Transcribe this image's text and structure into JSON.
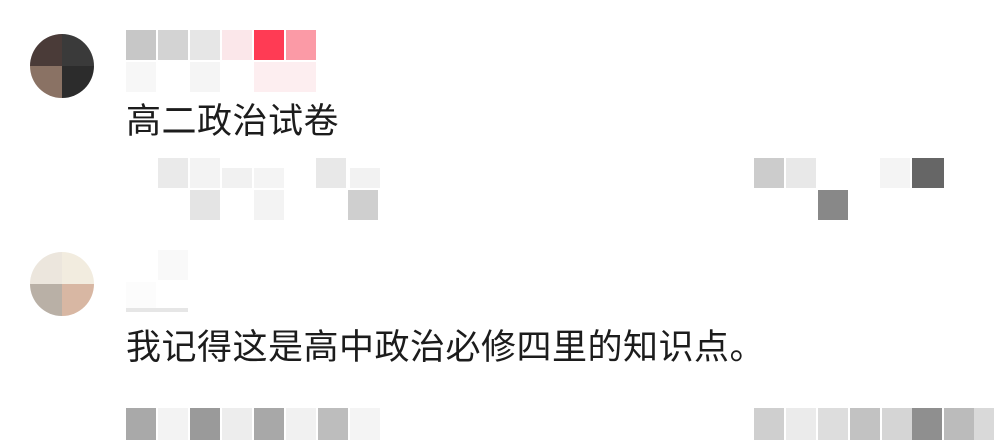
{
  "comments": [
    {
      "text": "高二政治试卷",
      "avatar_colors": [
        "#4a3b38",
        "#3a3a3a",
        "#8a7264",
        "#2c2c2c"
      ]
    },
    {
      "text": "我记得这是高中政治必修四里的知识点。",
      "avatar_colors": [
        "#ece6dd",
        "#f2ecdf",
        "#b9b0a6",
        "#d8b7a3"
      ]
    }
  ],
  "colors": {
    "text": "#1c1c1c",
    "pixelated_username_accent": "#ff3b54",
    "background": "#ffffff"
  },
  "icons": {
    "pixelated_username": "pixelated-username-block",
    "pixelated_meta": "pixelated-meta-info",
    "pixelated_action": "pixelated-action-icon"
  }
}
